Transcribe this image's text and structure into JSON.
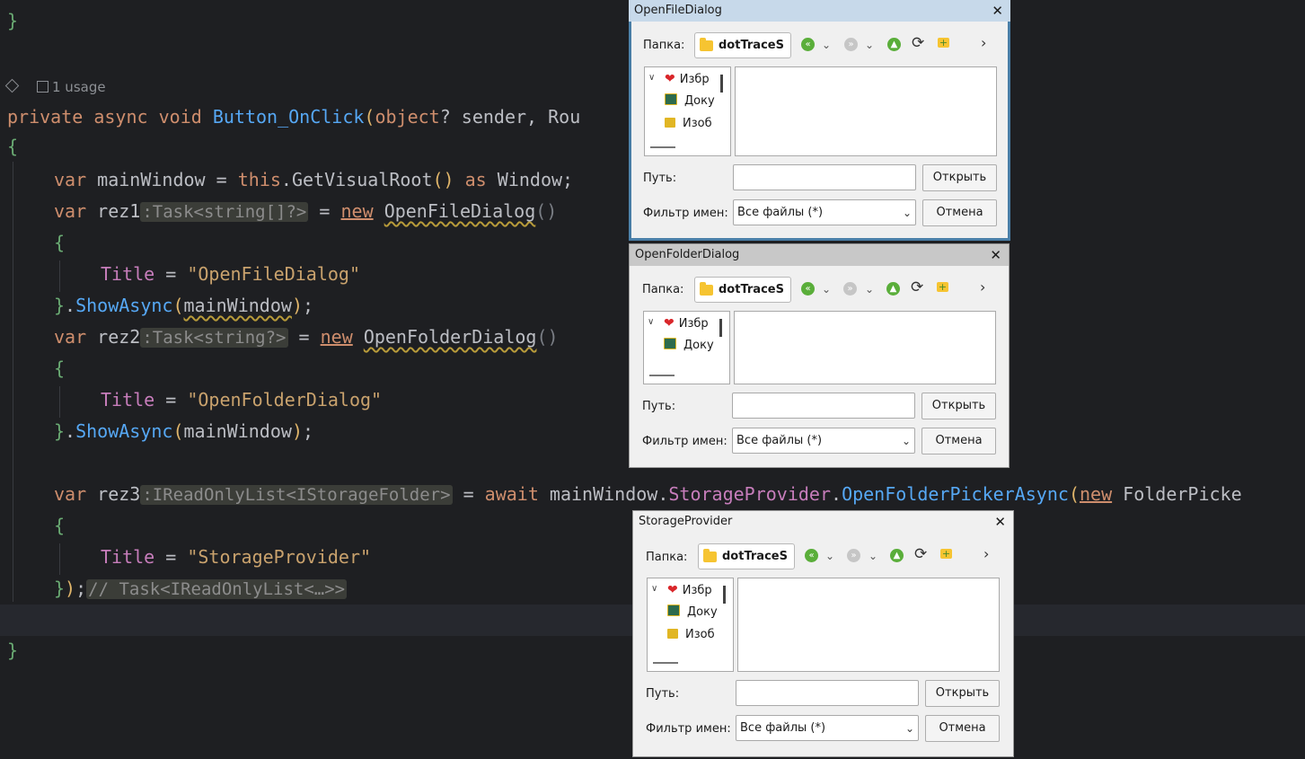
{
  "editor": {
    "usage_label": "1 usage",
    "lines": {
      "close_brace_top": "}",
      "kw_private": "private",
      "kw_async": "async",
      "kw_void": "void",
      "method_name": "Button_OnClick",
      "kw_object": "object",
      "param_sender": "? sender, Rou",
      "open_brace": "{",
      "kw_var": "var",
      "mainWindow": "mainWindow",
      "eq": "=",
      "kw_this": "this",
      "get_visual_root": "GetVisualRoot",
      "kw_as": "as",
      "window_type": "Window;",
      "rez1": "rez1",
      "rez1_hint": ":Task<string[]?>",
      "kw_new": "new",
      "open_file_dialog": "OpenFileDialog",
      "title_prop": "Title",
      "title1": "\"OpenFileDialog\"",
      "show_async": "ShowAsync",
      "main_window_arg": "mainWindow",
      "rez2": "rez2",
      "rez2_hint": ":Task<string?>",
      "open_folder_dialog": "OpenFolderDialog",
      "title2": "\"OpenFolderDialog\"",
      "rez3": "rez3",
      "rez3_hint": ":IReadOnlyList<IStorageFolder>",
      "kw_await": "await",
      "storage_provider": "StorageProvider",
      "open_folder_picker": "OpenFolderPickerAsync",
      "folder_picker": "FolderPicke",
      "title3": "\"StorageProvider\"",
      "end_comment": "// Task<IReadOnlyList<…>>",
      "close_brace_bottom": "}"
    }
  },
  "dialogs": [
    {
      "title": "OpenFileDialog",
      "folder_label": "Папка:",
      "folder_value": "dotTraceS",
      "tree_items": [
        "Избр",
        "Доку",
        "Изоб"
      ],
      "path_label": "Путь:",
      "open_button": "Открыть",
      "filter_label": "Фильтр имен:",
      "filter_value": "Все файлы (*)",
      "cancel_button": "Отмена"
    },
    {
      "title": "OpenFolderDialog",
      "folder_label": "Папка:",
      "folder_value": "dotTraceS",
      "tree_items": [
        "Избр",
        "Доку"
      ],
      "path_label": "Путь:",
      "open_button": "Открыть",
      "filter_label": "Фильтр имен:",
      "filter_value": "Все файлы (*)",
      "cancel_button": "Отмена"
    },
    {
      "title": "StorageProvider",
      "folder_label": "Папка:",
      "folder_value": "dotTraceS",
      "tree_items": [
        "Избр",
        "Доку",
        "Изоб"
      ],
      "path_label": "Путь:",
      "open_button": "Открыть",
      "filter_label": "Фильтр имен:",
      "filter_value": "Все файлы (*)",
      "cancel_button": "Отмена"
    }
  ],
  "colors": {
    "editor_bg": "#1e1f22",
    "dialog_active_border": "#4a7fa8",
    "dialog_inactive_titlebar": "#c8c8c8",
    "dialog_active_titlebar": "#c7d9ea"
  },
  "icons": [
    "back-icon",
    "chevron-down-icon",
    "forward-icon",
    "up-icon",
    "refresh-icon",
    "new-folder-icon",
    "more-icon",
    "folder-icon",
    "favorites-heart-icon",
    "documents-icon",
    "images-icon",
    "close-icon"
  ]
}
